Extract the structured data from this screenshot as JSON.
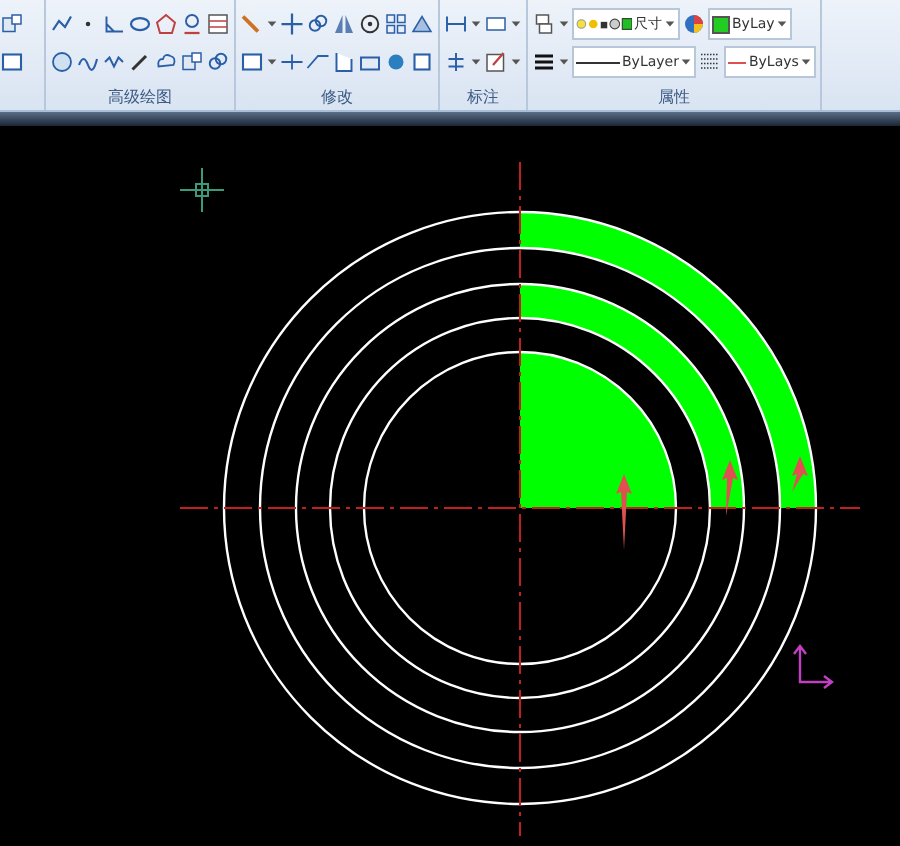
{
  "ribbon": {
    "groups": [
      {
        "label": "高级绘图"
      },
      {
        "label": "修改"
      },
      {
        "label": "标注"
      },
      {
        "label": "属性",
        "controls": [
          {
            "kind": "layer",
            "text": "尺寸"
          },
          {
            "kind": "color",
            "text": "ByLay",
            "color": "#22cc22"
          },
          {
            "kind": "linetype",
            "text": "ByLayer"
          },
          {
            "kind": "lineweight",
            "text": "ByLays",
            "color": "#e05050"
          }
        ]
      }
    ]
  }
}
